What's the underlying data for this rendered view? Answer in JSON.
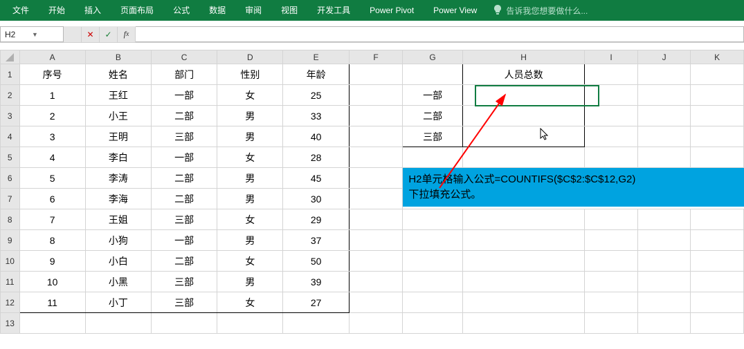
{
  "ribbon": {
    "tabs": [
      "文件",
      "开始",
      "插入",
      "页面布局",
      "公式",
      "数据",
      "审阅",
      "视图",
      "开发工具",
      "Power Pivot",
      "Power View"
    ],
    "tellme": "告诉我您想要做什么..."
  },
  "namebox": {
    "value": "H2"
  },
  "columns": [
    "A",
    "B",
    "C",
    "D",
    "E",
    "F",
    "G",
    "H",
    "I",
    "J",
    "K"
  ],
  "rows": [
    "1",
    "2",
    "3",
    "4",
    "5",
    "6",
    "7",
    "8",
    "9",
    "10",
    "11",
    "12",
    "13"
  ],
  "main_table": {
    "headers": {
      "A": "序号",
      "B": "姓名",
      "C": "部门",
      "D": "性别",
      "E": "年龄"
    },
    "rows": [
      {
        "A": "1",
        "B": "王红",
        "C": "一部",
        "D": "女",
        "E": "25"
      },
      {
        "A": "2",
        "B": "小王",
        "C": "二部",
        "D": "男",
        "E": "33"
      },
      {
        "A": "3",
        "B": "王明",
        "C": "三部",
        "D": "男",
        "E": "40"
      },
      {
        "A": "4",
        "B": "李白",
        "C": "一部",
        "D": "女",
        "E": "28"
      },
      {
        "A": "5",
        "B": "李涛",
        "C": "二部",
        "D": "男",
        "E": "45"
      },
      {
        "A": "6",
        "B": "李海",
        "C": "二部",
        "D": "男",
        "E": "30"
      },
      {
        "A": "7",
        "B": "王姐",
        "C": "三部",
        "D": "女",
        "E": "29"
      },
      {
        "A": "8",
        "B": "小狗",
        "C": "一部",
        "D": "男",
        "E": "37"
      },
      {
        "A": "9",
        "B": "小白",
        "C": "二部",
        "D": "女",
        "E": "50"
      },
      {
        "A": "10",
        "B": "小黑",
        "C": "三部",
        "D": "男",
        "E": "39"
      },
      {
        "A": "11",
        "B": "小丁",
        "C": "三部",
        "D": "女",
        "E": "27"
      }
    ]
  },
  "summary_table": {
    "header_H": "人员总数",
    "rows": [
      {
        "G": "一部",
        "H": ""
      },
      {
        "G": "二部",
        "H": ""
      },
      {
        "G": "三部",
        "H": ""
      }
    ]
  },
  "annotation": {
    "line1": "H2单元格输入公式=COUNTIFS($C$2:$C$12,G2)",
    "line2": "下拉填充公式。"
  }
}
